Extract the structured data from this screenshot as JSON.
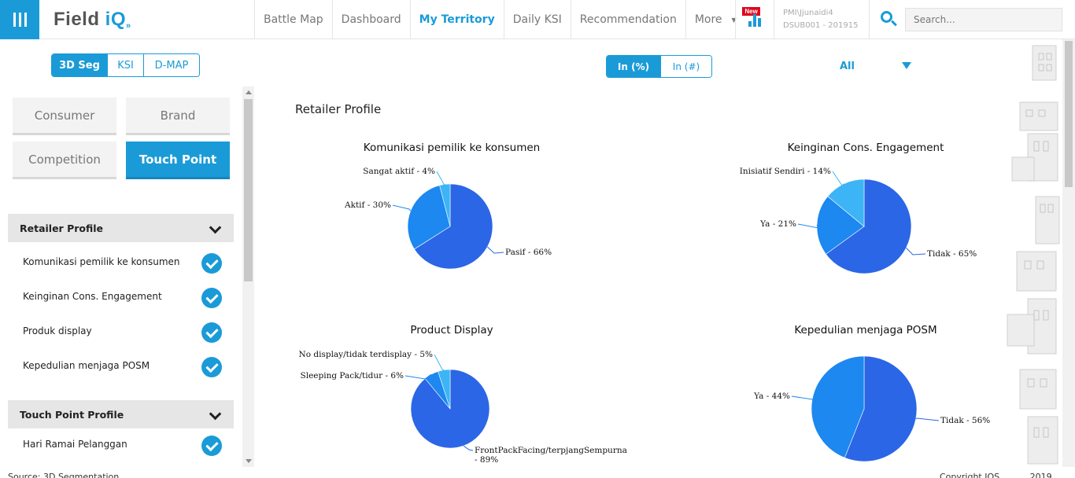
{
  "app": {
    "logo_main": "Field ",
    "logo_accent": "iQ",
    "logo_suffix": "»",
    "search_placeholder": "Search...",
    "user_name": "PMI\\Jjunaidi4",
    "user_code": "DSUB001 - 201915"
  },
  "nav": {
    "items": [
      {
        "label": "Battle Map"
      },
      {
        "label": "Dashboard"
      },
      {
        "label": "My Territory"
      },
      {
        "label": "Daily KSI"
      },
      {
        "label": "Recommendation"
      },
      {
        "label": "More"
      }
    ],
    "active": "My Territory",
    "new_badge": "New"
  },
  "toggles": {
    "view": [
      "3D Seg",
      "KSI",
      "D-MAP"
    ],
    "view_active": "3D Seg",
    "unit": [
      "In (%)",
      "In (#)"
    ],
    "unit_active": "In (%)",
    "filter_value": "All"
  },
  "sidebar": {
    "categories": [
      "Consumer",
      "Brand",
      "Competition",
      "Touch Point"
    ],
    "active_category": "Touch Point",
    "sections": [
      {
        "title": "Retailer Profile",
        "items": [
          "Komunikasi pemilik ke konsumen",
          "Keinginan Cons. Engagement",
          "Produk display",
          "Kepedulian menjaga POSM"
        ]
      },
      {
        "title": "Touch Point Profile",
        "items": [
          "Hari Ramai Pelanggan"
        ]
      }
    ]
  },
  "main": {
    "title": "Retailer Profile"
  },
  "footer": {
    "left": "Source: 3D Segmentation",
    "right": "Copyright IQS ......... 2019"
  },
  "colors": {
    "accent": "#1a9bd7",
    "slice_dark": "#2b66e6",
    "slice_mid": "#1c88f0",
    "slice_light": "#3db4f5"
  },
  "chart_data": [
    {
      "type": "pie",
      "title": "Komunikasi pemilik ke konsumen",
      "slices": [
        {
          "label": "Pasif - 66%",
          "value": 66
        },
        {
          "label": "Aktif - 30%",
          "value": 30
        },
        {
          "label": "Sangat aktif - 4%",
          "value": 4
        }
      ]
    },
    {
      "type": "pie",
      "title": "Keinginan Cons. Engagement",
      "slices": [
        {
          "label": "Tidak - 65%",
          "value": 65
        },
        {
          "label": "Ya - 21%",
          "value": 21
        },
        {
          "label": "Inisiatif Sendiri - 14%",
          "value": 14
        }
      ]
    },
    {
      "type": "pie",
      "title": "Product Display",
      "slices": [
        {
          "label": "FrontPackFacing/terpjangSempurna - 89%",
          "value": 89
        },
        {
          "label": "Sleeping Pack/tidur - 6%",
          "value": 6
        },
        {
          "label": "No display/tidak terdisplay - 5%",
          "value": 5
        }
      ]
    },
    {
      "type": "pie",
      "title": "Kepedulian menjaga POSM",
      "slices": [
        {
          "label": "Tidak - 56%",
          "value": 56
        },
        {
          "label": "Ya - 44%",
          "value": 44
        }
      ]
    }
  ]
}
